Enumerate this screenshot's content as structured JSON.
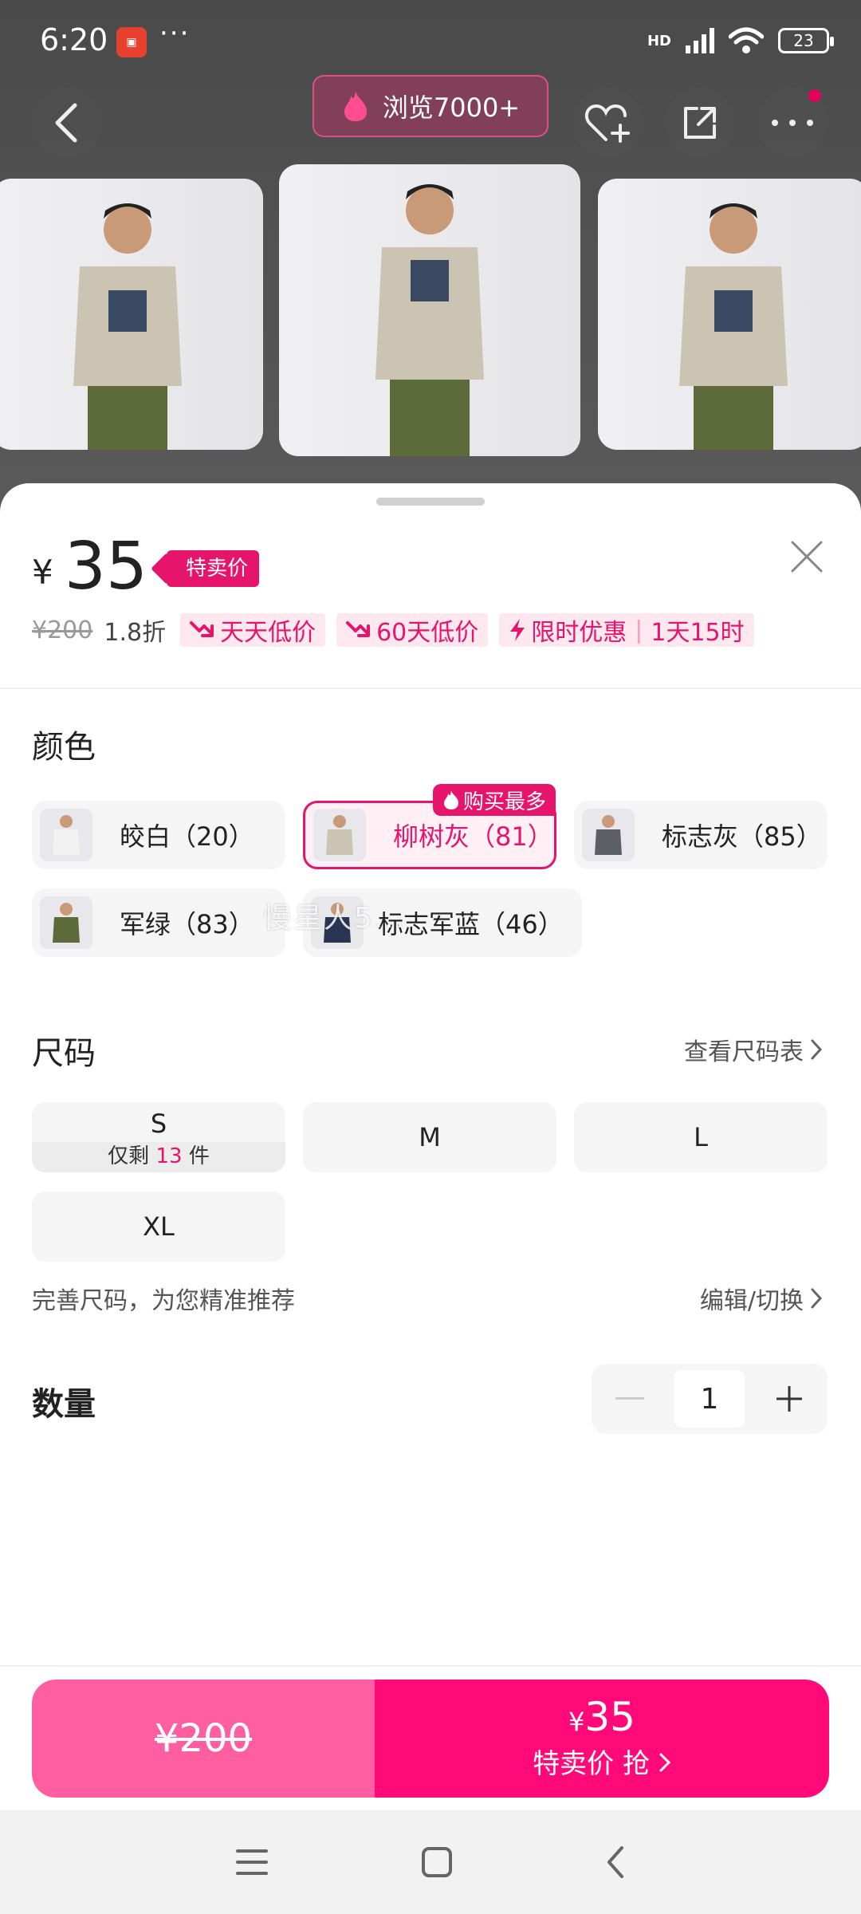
{
  "status_bar": {
    "time": "6:20",
    "dots": "···",
    "net": "HD",
    "battery": "23"
  },
  "header": {
    "views": "浏览7000+"
  },
  "product": {
    "currency": "¥",
    "price": "35",
    "special_tag": "特卖价",
    "original_price": "¥200",
    "discount": "1.8折",
    "chips": [
      {
        "label": "天天低价"
      },
      {
        "label": "60天低价"
      },
      {
        "label": "限时优惠",
        "extra": "1天15时"
      }
    ]
  },
  "color_section": {
    "title": "颜色",
    "best_seller_tag": "购买最多",
    "options": [
      {
        "label": "皎白（20）",
        "shirt": "#f2f2f2"
      },
      {
        "label": "柳树灰（81）",
        "shirt": "#cbc4b3"
      },
      {
        "label": "标志灰（85）",
        "shirt": "#5b5e63"
      },
      {
        "label": "军绿（83）",
        "shirt": "#5d6b3a"
      },
      {
        "label": "标志军蓝（46）",
        "shirt": "#2a3553"
      }
    ]
  },
  "size_section": {
    "title": "尺码",
    "chart_link": "查看尺码表",
    "sizes": [
      "S",
      "M",
      "L",
      "XL"
    ],
    "stock_prefix": "仅剩",
    "stock_count": "13",
    "stock_suffix": "件",
    "hint": "完善尺码，为您精准推荐",
    "edit_link": "编辑/切换"
  },
  "quantity_section": {
    "title": "数量",
    "value": "1"
  },
  "watermark": "慢星人5...",
  "bottom_bar": {
    "left_price": "¥200",
    "right_currency": "¥",
    "right_price": "35",
    "right_label": "特卖价 抢"
  },
  "colors": {
    "accent": "#e6146a",
    "buy_left": "#ff5fa0",
    "buy_right": "#ff0a78"
  }
}
